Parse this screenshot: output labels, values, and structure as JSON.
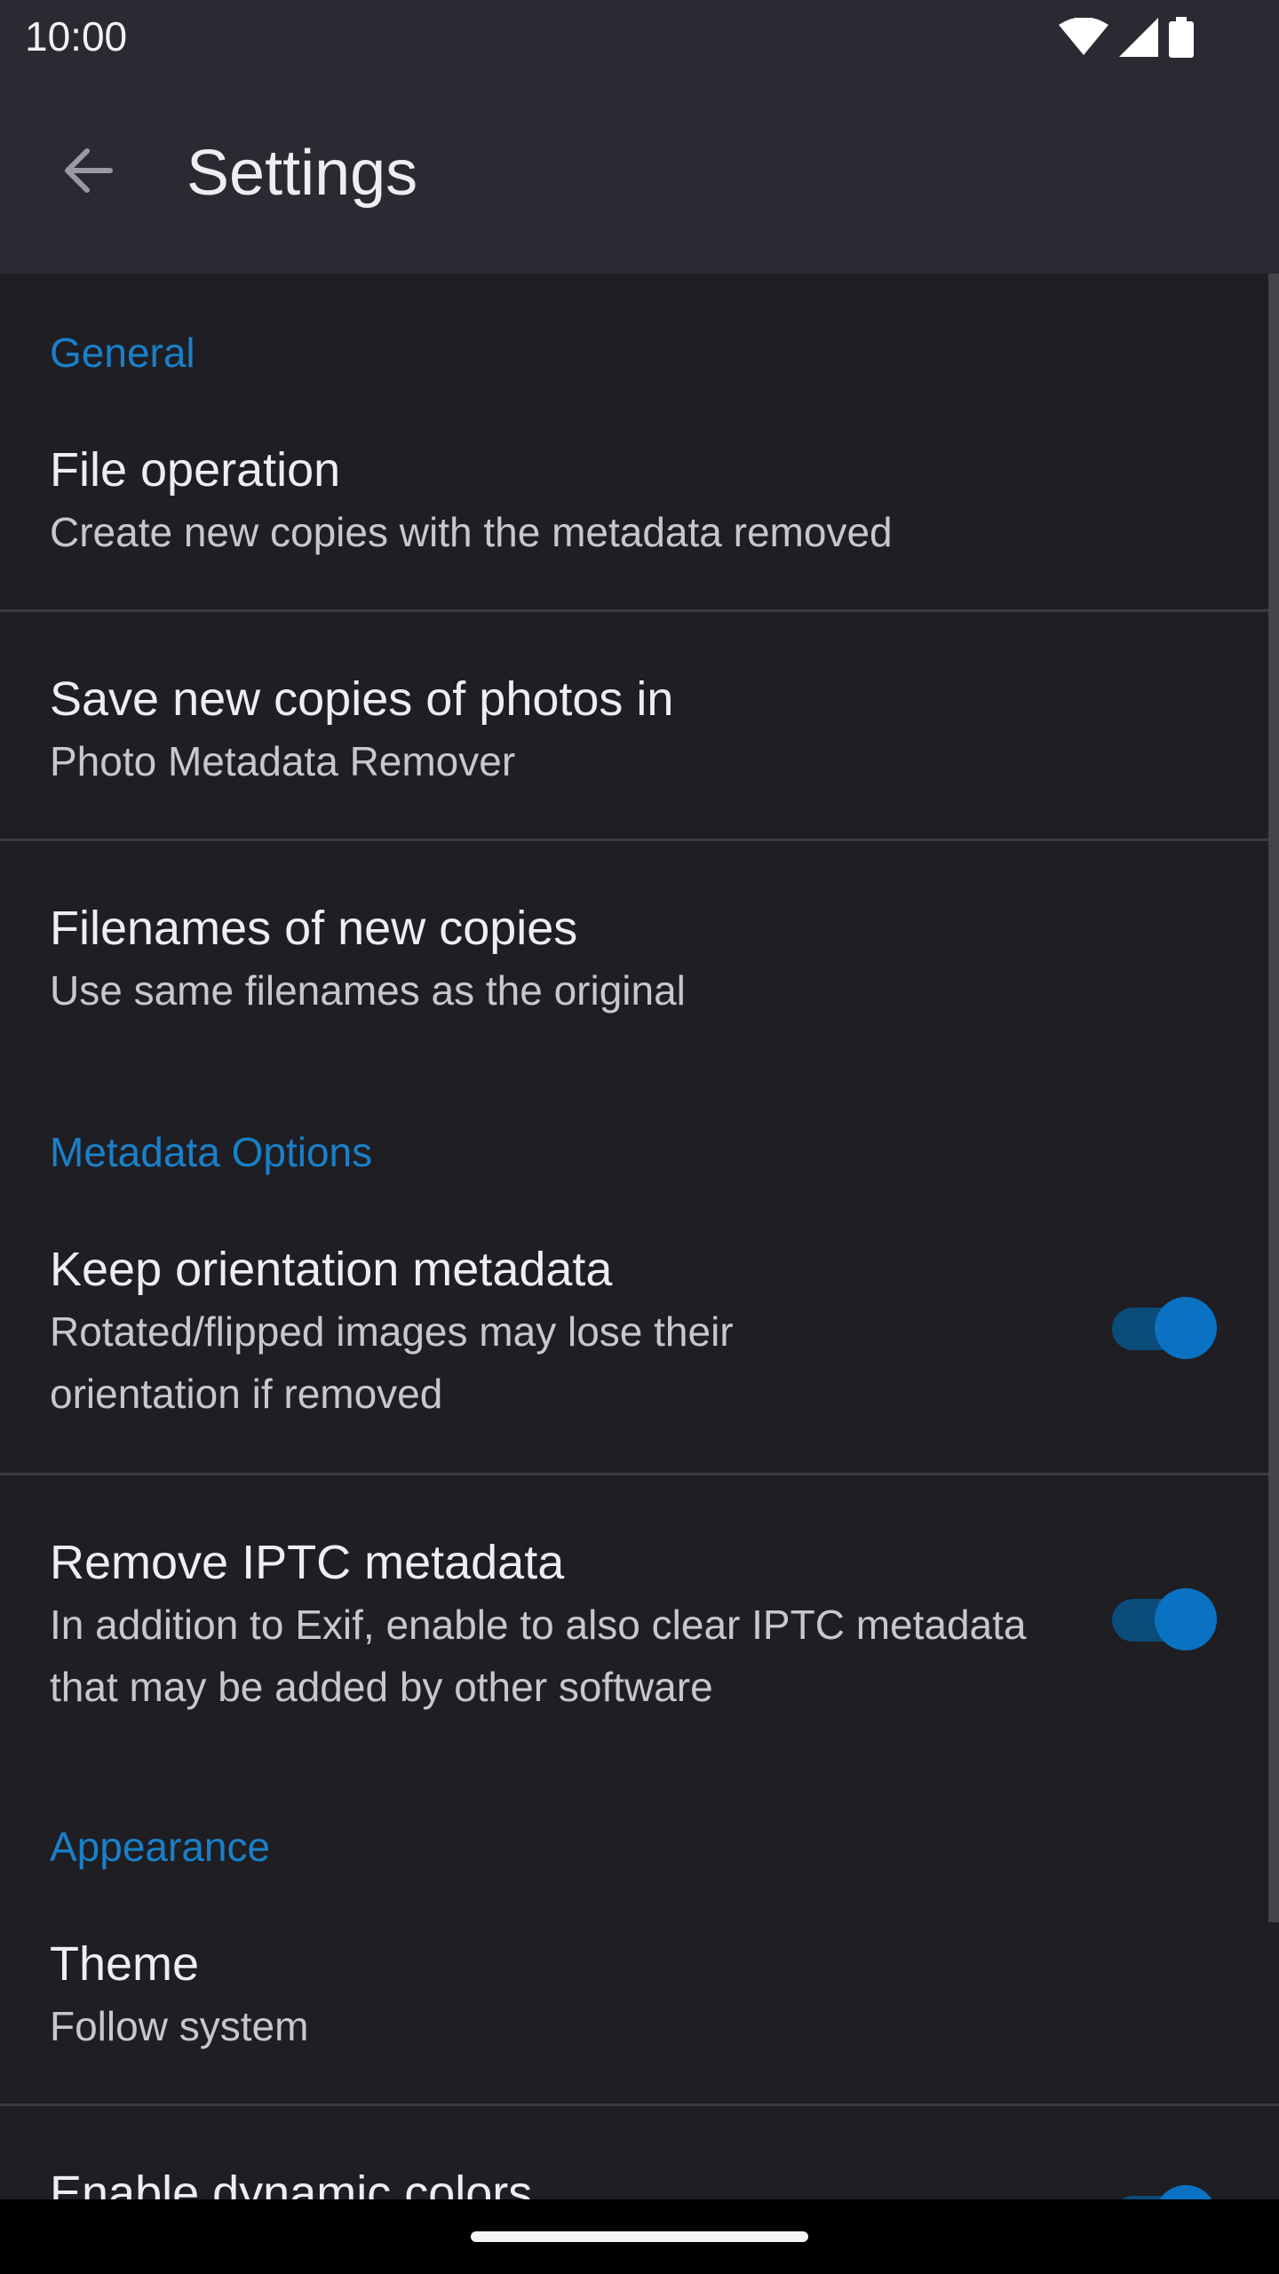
{
  "status_bar": {
    "time": "10:00",
    "icons": [
      "wifi-icon",
      "cellular-signal-icon",
      "battery-icon"
    ]
  },
  "app_bar": {
    "title": "Settings",
    "back_icon": "arrow-left-icon"
  },
  "sections": {
    "general": {
      "header": "General",
      "file_operation": {
        "title": "File operation",
        "summary": "Create new copies with the metadata removed"
      },
      "save_location": {
        "title": "Save new copies of photos in",
        "summary": "Photo Metadata Remover"
      },
      "filenames": {
        "title": "Filenames of new copies",
        "summary": "Use same filenames as the original"
      }
    },
    "metadata": {
      "header": "Metadata Options",
      "keep_orientation": {
        "title": "Keep orientation metadata",
        "summary": "Rotated/flipped images may lose their orientation if removed",
        "enabled": true
      },
      "remove_iptc": {
        "title": "Remove IPTC metadata",
        "summary": "In addition to Exif, enable to also clear IPTC metadata that may be added by other software",
        "enabled": true
      }
    },
    "appearance": {
      "header": "Appearance",
      "theme": {
        "title": "Theme",
        "summary": "Follow system"
      },
      "dynamic_colors": {
        "title": "Enable dynamic colors",
        "enabled": true
      }
    }
  },
  "colors": {
    "accent": "#1a80c8",
    "background": "#1e1e23",
    "app_bar": "#2a2a33",
    "switch_thumb": "#0a72c2",
    "switch_track": "#0b4c7a"
  }
}
